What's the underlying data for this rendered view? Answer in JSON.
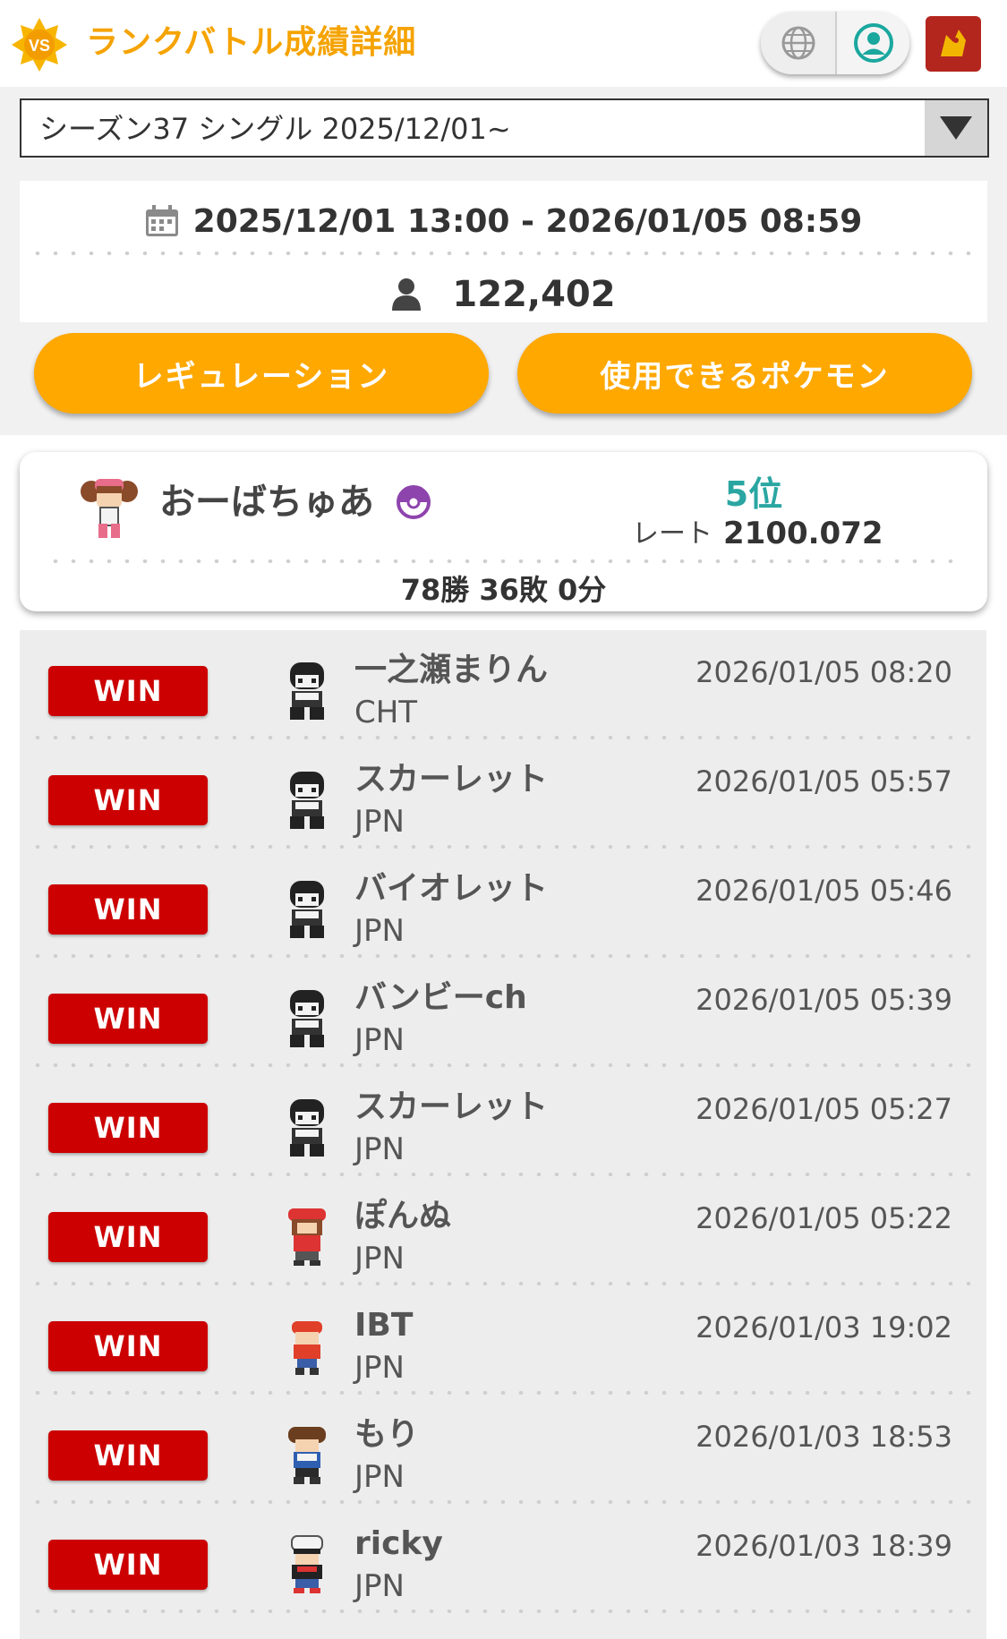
{
  "header": {
    "badge_text": "VS",
    "title": "ランクバトル成績詳細",
    "icons": [
      "globe-icon",
      "profile-icon",
      "crest-icon"
    ],
    "accent_color": "#f5a300"
  },
  "season_select": {
    "selected": "シーズン37 シングル 2025/12/01~"
  },
  "info": {
    "period": "2025/12/01 13:00 - 2026/01/05 08:59",
    "players": "122,402"
  },
  "buttons": {
    "regulation": "レギュレーション",
    "usable_pokemon": "使用できるポケモン"
  },
  "player": {
    "name": "おーばちゅあ",
    "rank": "5位",
    "rate_label": "レート",
    "rate": "2100.072",
    "record": "78勝 36敗 0分"
  },
  "battles": [
    {
      "result": "WIN",
      "name": "一之瀬まりん",
      "country": "CHT",
      "date": "2026/01/05 08:20",
      "sprite": "black-hood"
    },
    {
      "result": "WIN",
      "name": "スカーレット",
      "country": "JPN",
      "date": "2026/01/05 05:57",
      "sprite": "black-hood"
    },
    {
      "result": "WIN",
      "name": "バイオレット",
      "country": "JPN",
      "date": "2026/01/05 05:46",
      "sprite": "black-hood"
    },
    {
      "result": "WIN",
      "name": "バンビーch",
      "country": "JPN",
      "date": "2026/01/05 05:39",
      "sprite": "black-hood"
    },
    {
      "result": "WIN",
      "name": "スカーレット",
      "country": "JPN",
      "date": "2026/01/05 05:27",
      "sprite": "black-hood"
    },
    {
      "result": "WIN",
      "name": "ぽんぬ",
      "country": "JPN",
      "date": "2026/01/05 05:22",
      "sprite": "red-girl"
    },
    {
      "result": "WIN",
      "name": "IBT",
      "country": "JPN",
      "date": "2026/01/03 19:02",
      "sprite": "red-cap"
    },
    {
      "result": "WIN",
      "name": "もり",
      "country": "JPN",
      "date": "2026/01/03 18:53",
      "sprite": "brown-boy"
    },
    {
      "result": "WIN",
      "name": "ricky",
      "country": "JPN",
      "date": "2026/01/03 18:39",
      "sprite": "white-cap"
    }
  ]
}
